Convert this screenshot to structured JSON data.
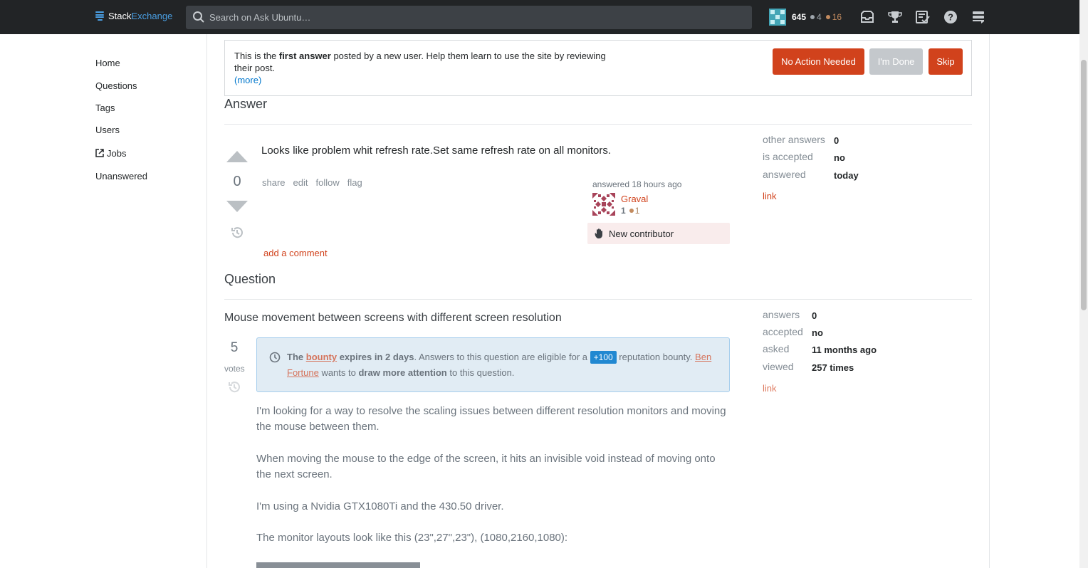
{
  "topbar": {
    "logo_stack": "Stack",
    "logo_exchange": "Exchange",
    "search_placeholder": "Search on Ask Ubuntu…",
    "reputation": "645",
    "silver_badges": "4",
    "bronze_badges": "16",
    "icons": [
      "inbox-icon",
      "achievements-icon",
      "review-queues-icon",
      "help-icon",
      "site-switcher-icon"
    ]
  },
  "leftnav": {
    "items": [
      "Home",
      "Questions",
      "Tags",
      "Users",
      "Jobs",
      "Unanswered"
    ]
  },
  "review": {
    "text_pre": "This is the ",
    "text_bold": "first answer",
    "text_post": " posted by a new user. Help them learn to use the site by reviewing their post.",
    "more": "(more)",
    "btn_no_action": "No Action Needed",
    "btn_done": "I'm Done",
    "btn_skip": "Skip"
  },
  "answer": {
    "section_title": "Answer",
    "votes": "0",
    "body": "Looks like problem whit refresh rate.Set same refresh rate on all monitors.",
    "menu": [
      "share",
      "edit",
      "follow",
      "flag"
    ],
    "user_action": "answered 18 hours ago",
    "user_name": "Graval",
    "user_rep": "1",
    "user_bronze": "1",
    "new_contributor": "New contributor",
    "add_comment": "add a comment",
    "meta": {
      "other_answers_label": "other answers",
      "other_answers": "0",
      "accepted_label": "is accepted",
      "accepted": "no",
      "answered_label": "answered",
      "answered": "today",
      "link": "link"
    }
  },
  "question": {
    "section_title": "Question",
    "title": "Mouse movement between screens with different screen resolution",
    "votes": "5",
    "votes_label": "votes",
    "bounty": {
      "the": "The",
      "bounty_word": "bounty",
      "expires": "expires in 2 days",
      "mid": ". Answers to this question are eligible for a",
      "amount": "+100",
      "after": "reputation bounty.",
      "user": "Ben Fortune",
      "wants": "wants to",
      "draw": "draw more attention",
      "end": "to this question."
    },
    "paragraphs": [
      "I'm looking for a way to resolve the scaling issues between different resolution monitors and moving the mouse between them.",
      "When moving the mouse to the edge of the screen, it hits an invisible void instead of moving onto the next screen.",
      "I'm using a Nvidia GTX1080Ti and the 430.50 driver.",
      "The monitor layouts look like this (23\",27\",23\"), (1080,2160,1080):"
    ],
    "meta": {
      "answers_label": "answers",
      "answers": "0",
      "accepted_label": "accepted",
      "accepted": "no",
      "asked_label": "asked",
      "asked": "11 months ago",
      "viewed_label": "viewed",
      "viewed": "257 times",
      "link": "link"
    }
  },
  "colors": {
    "topbar": "#222426",
    "accent_red": "#d1421c",
    "link_blue": "#0077cc",
    "bounty_bg": "#e1ecf4"
  }
}
